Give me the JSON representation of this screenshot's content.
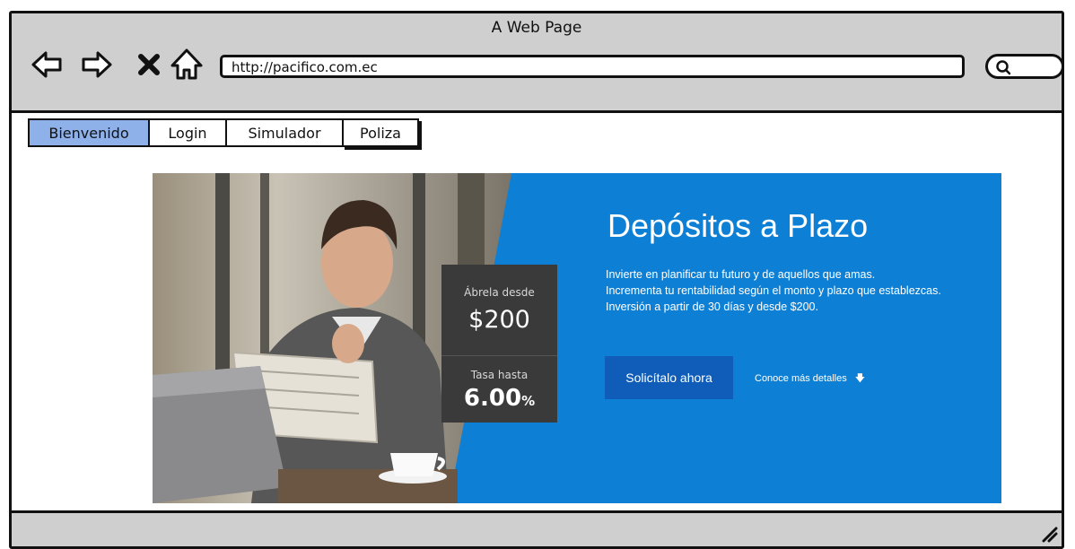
{
  "window": {
    "title": "A Web Page",
    "url": "http://pacifico.com.ec",
    "nav_icons": [
      "back-arrow-icon",
      "forward-arrow-icon",
      "close-x-icon",
      "home-icon",
      "search-icon",
      "resize-handle-icon"
    ]
  },
  "tabs": [
    {
      "label": "Bienvenido",
      "active": true
    },
    {
      "label": "Login",
      "active": false
    },
    {
      "label": "Simulador",
      "active": false
    },
    {
      "label": "Poliza",
      "active": false
    }
  ],
  "banner": {
    "headline": "Depósitos a Plazo",
    "desc_line1": "Invierte en planificar tu futuro y de aquellos que amas.",
    "desc_line2": "Incrementa tu rentabilidad según el monto y plazo que establezcas.",
    "desc_line3": "Inversión a partir de 30 días y desde $200.",
    "badge_label1": "Ábrela desde",
    "badge_value1": "$200",
    "badge_label2": "Tasa hasta",
    "badge_value2": "6.00",
    "badge_value2_suffix": "%",
    "cta_label": "Solicítalo ahora",
    "more_label": "Conoce más detalles",
    "accent_color": "#0d80d6",
    "cta_color": "#0f5db9",
    "badge_color": "#3a3a3a"
  },
  "colors": {
    "chrome_gray": "#cfcfcf",
    "active_tab": "#8fb1ea"
  }
}
